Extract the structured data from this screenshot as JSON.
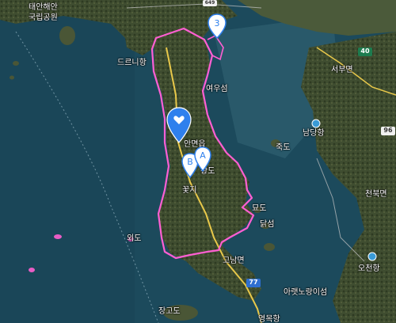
{
  "map": {
    "place_labels": {
      "national_park_line1": "태안해안",
      "national_park_line2": "국립공원",
      "drunamu": "드르니항",
      "yeouseom": "여우섬",
      "anmyeon": "안면읍",
      "juksdo": "죽도",
      "namdang": "남당항",
      "seobu": "서부면",
      "cheonbuk": "천북면",
      "kkotji": "꽃지",
      "hwangdo": "황도",
      "myodo": "묘도",
      "dalseom": "닭섬",
      "gonam": "고남면",
      "oedo": "외도",
      "ocheon": "오천항",
      "areppnorang": "아랫노랑이섬",
      "janggodo": "장고도",
      "bottom_partial": "영목항"
    },
    "road_shields": {
      "r40": "40",
      "r96": "96",
      "r77": "77",
      "r649": "649"
    },
    "markers": {
      "m3": "3",
      "mA": "A",
      "mB": "B"
    },
    "colors": {
      "sea": "#1c4a5c",
      "land": "#3a4a2e",
      "boundary": "#ff5fd2",
      "marker": "#2f80ed"
    }
  }
}
